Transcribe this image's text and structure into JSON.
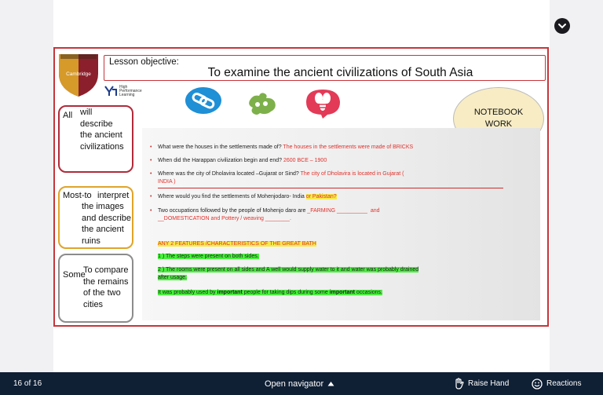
{
  "slide": {
    "logo_text": "Cambridge",
    "hpl_text": [
      "High",
      "Performance",
      "Learning"
    ],
    "objective_label": "Lesson objective:",
    "objective_title": "To examine the ancient civilizations of South Asia",
    "notebook_lines": [
      "NOTEBOOK",
      "WORK"
    ],
    "levels": [
      {
        "key": "All",
        "lines": [
          "will",
          "describe",
          "the ancient",
          "civilizations"
        ]
      },
      {
        "key": "Most-to",
        "lines": [
          "interpret",
          "the images",
          "and describe",
          "the ancient",
          "ruins"
        ]
      },
      {
        "key": "Some",
        "lines": [
          "To compare",
          "the remains",
          "of the two",
          "cities"
        ]
      }
    ],
    "questions": [
      {
        "q": "What were the houses in the settlements made of?",
        "a": "The houses in the settlements were made of BRICKS"
      },
      {
        "q": "When did the Harappan civilization begin and end?",
        "a": "2600 BCE – 1900"
      },
      {
        "q": "Where was the city of Dholavira located –Gujarat or Sind?",
        "a": "The city of Dholavira is located in Gujarat (",
        "a2": "INDIA )"
      },
      {
        "q": "Where would you find the settlements of Mohenjodaro- India",
        "a": "or Pakistan?"
      },
      {
        "q": "Two occupations followed by the people of Mohenjo daro are",
        "a": "_FARMING __________",
        "mid": "and",
        "a2": "__DOMESTICATION and Pottery / weaving ________."
      }
    ],
    "features": {
      "heading": "ANY 2 FEATURES /CHARACTERISTICS OF THE GREAT BATH",
      "f1": "1 ) The steps were present on both sides.",
      "f2a": "2 ) The rooms were present on all sides and A well would supply water to it and water was probably drained",
      "f2b": "after usage.",
      "f3_parts": [
        "It was probably used by ",
        "important",
        " people for taking dips during some ",
        "important",
        " occasions."
      ]
    }
  },
  "toolbar": {
    "page_counter": "16 of 16",
    "open_navigator": "Open navigator",
    "raise_hand": "Raise Hand",
    "reactions": "Reactions"
  },
  "colors": {
    "accent_red": "#c7353a",
    "bar": "#0f1f34"
  }
}
